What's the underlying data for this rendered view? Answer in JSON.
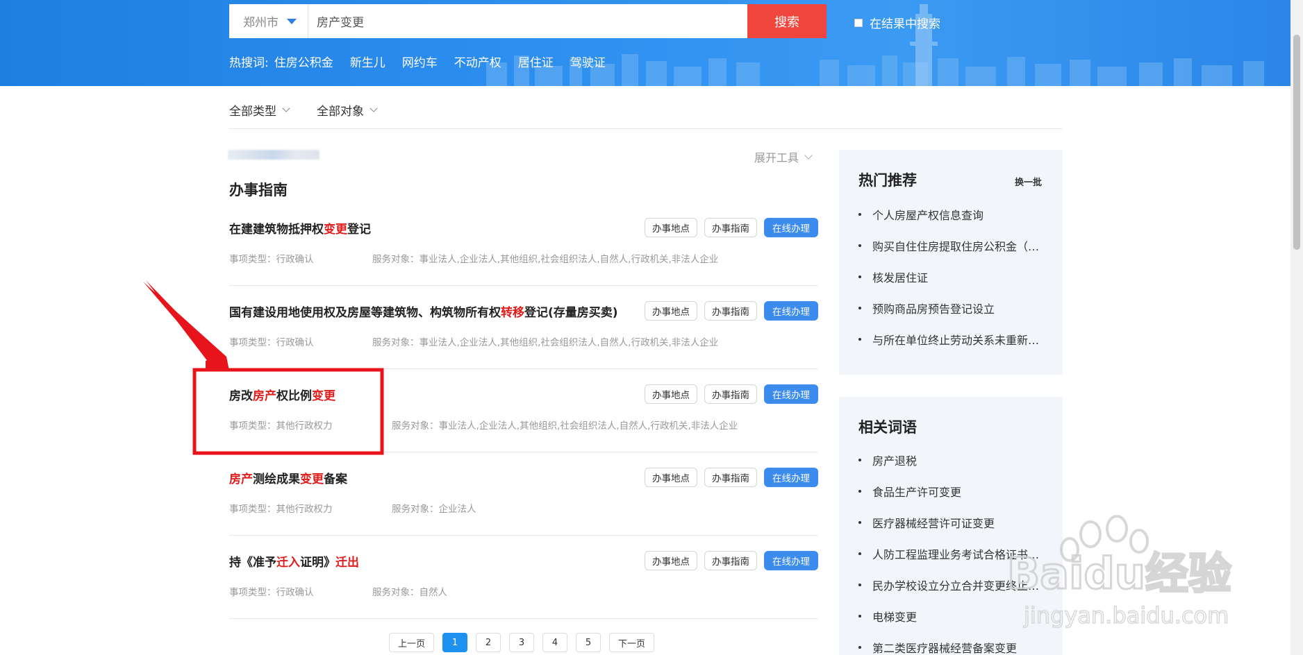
{
  "search": {
    "city": "郑州市",
    "query": "房产变更",
    "button_label": "搜索",
    "in_result_label": "在结果中搜索"
  },
  "hot_search": {
    "label": "热搜词:",
    "words": [
      "住房公积金",
      "新生儿",
      "网约车",
      "不动产权",
      "居住证",
      "驾驶证"
    ]
  },
  "filters": [
    "全部类型",
    "全部对象"
  ],
  "toolbar": {
    "expand_tools": "展开工具"
  },
  "section_title": "办事指南",
  "buttons": {
    "location": "办事地点",
    "guide": "办事指南",
    "online": "在线办理"
  },
  "items": [
    {
      "title_parts": [
        {
          "t": "在建建筑物抵押权",
          "h": false
        },
        {
          "t": "变更",
          "h": true
        },
        {
          "t": "登记",
          "h": false
        }
      ],
      "type": "事项类型：行政确认",
      "target": "服务对象：事业法人,企业法人,其他组织,社会组织法人,自然人,行政机关,非法人企业"
    },
    {
      "title_parts": [
        {
          "t": "国有建设用地使用权及房屋等建筑物、构筑物所有权",
          "h": false
        },
        {
          "t": "转移",
          "h": true
        },
        {
          "t": "登记(存量房买卖)",
          "h": false
        }
      ],
      "type": "事项类型：行政确认",
      "target": "服务对象：事业法人,企业法人,其他组织,社会组织法人,自然人,行政机关,非法人企业"
    },
    {
      "title_parts": [
        {
          "t": "房改",
          "h": false
        },
        {
          "t": "房产",
          "h": true
        },
        {
          "t": "权比例",
          "h": false
        },
        {
          "t": "变更",
          "h": true
        }
      ],
      "type": "事项类型：其他行政权力",
      "target": "服务对象：事业法人,企业法人,其他组织,社会组织法人,自然人,行政机关,非法人企业"
    },
    {
      "title_parts": [
        {
          "t": "房产",
          "h": true
        },
        {
          "t": "测绘成果",
          "h": false
        },
        {
          "t": "变更",
          "h": true
        },
        {
          "t": "备案",
          "h": false
        }
      ],
      "type": "事项类型：其他行政权力",
      "target": "服务对象：企业法人"
    },
    {
      "title_parts": [
        {
          "t": "持《准予",
          "h": false
        },
        {
          "t": "迁入",
          "h": true
        },
        {
          "t": "证明》",
          "h": false
        },
        {
          "t": "迁出",
          "h": true
        }
      ],
      "type": "事项类型：行政确认",
      "target": "服务对象：自然人"
    }
  ],
  "pagination": {
    "prev": "上一页",
    "pages": [
      "1",
      "2",
      "3",
      "4",
      "5"
    ],
    "current": "1",
    "next": "下一页"
  },
  "hot_recommend": {
    "title": "热门推荐",
    "refresh": "换一批",
    "items": [
      "个人房屋产权信息查询",
      "购买自住住房提取住房公积金（…",
      "核发居住证",
      "预购商品房预告登记设立",
      "与所在单位终止劳动关系未重新…"
    ]
  },
  "related_terms": {
    "title": "相关词语",
    "items": [
      "房产退税",
      "食品生产许可变更",
      "医疗器械经营许可证变更",
      "人防工程监理业务考试合格证书…",
      "民办学校设立分立合并变更终止…",
      "电梯变更",
      "第二类医疗器械经营备案变更"
    ]
  },
  "watermark": {
    "brand": "Baidu经验",
    "url": "jingyan.baidu.com"
  },
  "colors": {
    "banner": "#2d8ef0",
    "search_button": "#f0463d",
    "primary_button": "#3c8cf0",
    "highlight": "#e21b1b",
    "annotation": "#e8141b"
  }
}
